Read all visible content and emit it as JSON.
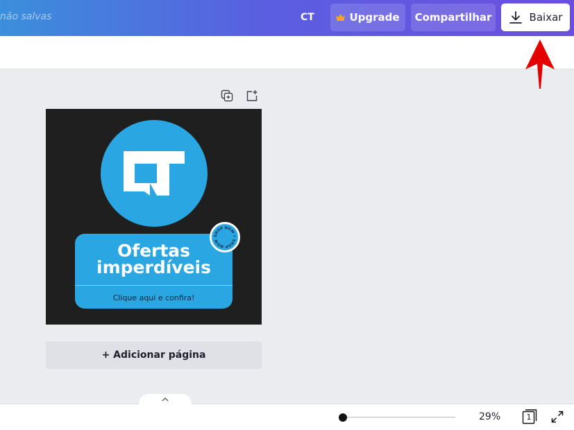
{
  "header": {
    "unsaved_text": "não salvas",
    "ct_label": "CT",
    "upgrade_label": "Upgrade",
    "share_label": "Compartilhar",
    "download_label": "Baixar"
  },
  "design": {
    "promo_title_line1": "Ofertas",
    "promo_title_line2": "imperdíveis",
    "promo_subtitle": "Clique aqui e confira!",
    "badge_text": "SHOP NOW • SHOP NOW •"
  },
  "canvas_actions": {
    "add_page_label": "+ Adicionar página"
  },
  "footer": {
    "zoom_value": "29%",
    "page_count": "1"
  },
  "icons": {
    "upgrade": "crown-icon",
    "download": "download-icon",
    "duplicate": "duplicate-page-icon",
    "add_page": "add-page-icon",
    "collapse": "chevron-up-icon",
    "pages": "pages-icon",
    "fullscreen": "fullscreen-icon"
  },
  "colors": {
    "header_start": "#3b8fdc",
    "header_end": "#6b4fe0",
    "brand_blue": "#2aa6e2",
    "canvas_bg": "#1f1f1f",
    "annotation_arrow": "#e50000"
  }
}
